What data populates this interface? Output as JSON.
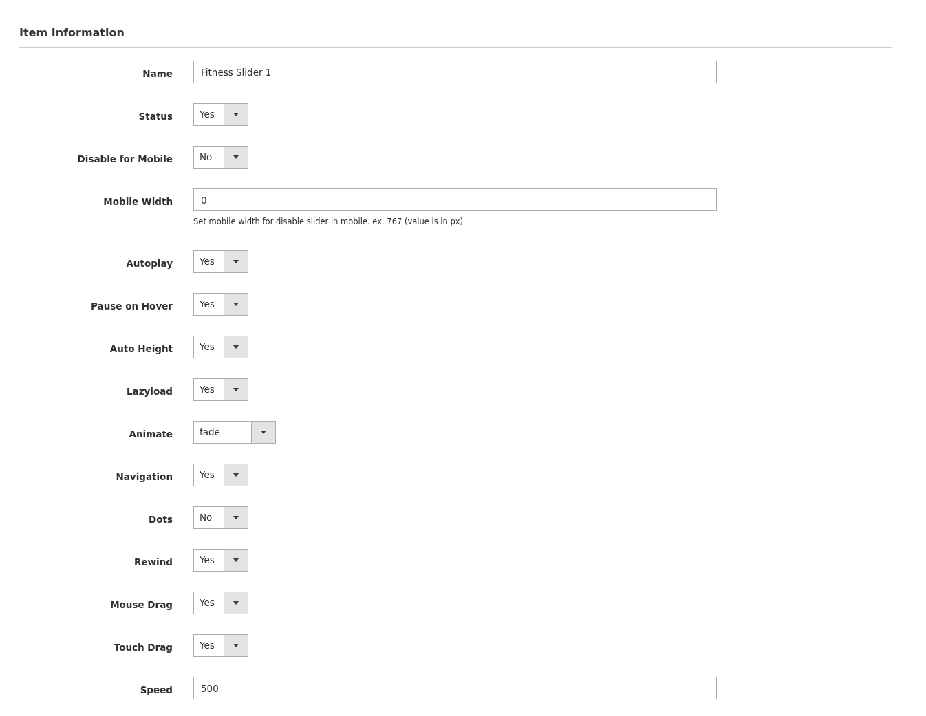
{
  "section": {
    "title": "Item Information"
  },
  "fields": [
    {
      "kind": "text",
      "label": "Name",
      "value": "Fitness Slider 1"
    },
    {
      "kind": "select",
      "label": "Status",
      "value": "Yes"
    },
    {
      "kind": "select",
      "label": "Disable for Mobile",
      "value": "No"
    },
    {
      "kind": "text",
      "label": "Mobile Width",
      "value": "0",
      "note": "Set mobile width for disable slider in mobile. ex. 767 (value is in px)"
    },
    {
      "kind": "select",
      "label": "Autoplay",
      "value": "Yes"
    },
    {
      "kind": "select",
      "label": "Pause on Hover",
      "value": "Yes"
    },
    {
      "kind": "select",
      "label": "Auto Height",
      "value": "Yes"
    },
    {
      "kind": "select",
      "label": "Lazyload",
      "value": "Yes"
    },
    {
      "kind": "wide-select",
      "label": "Animate",
      "value": "fade"
    },
    {
      "kind": "select",
      "label": "Navigation",
      "value": "Yes"
    },
    {
      "kind": "select",
      "label": "Dots",
      "value": "No"
    },
    {
      "kind": "select",
      "label": "Rewind",
      "value": "Yes"
    },
    {
      "kind": "select",
      "label": "Mouse Drag",
      "value": "Yes"
    },
    {
      "kind": "select",
      "label": "Touch Drag",
      "value": "Yes"
    },
    {
      "kind": "text",
      "label": "Speed",
      "value": "500"
    }
  ]
}
